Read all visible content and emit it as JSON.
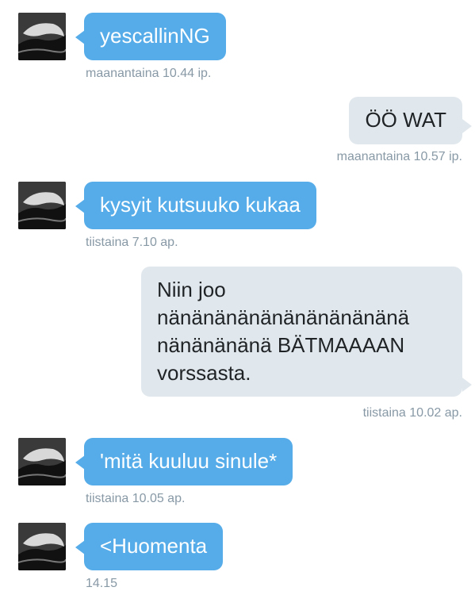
{
  "messages": [
    {
      "direction": "in",
      "text": "yescallinNG",
      "time": "maanantaina 10.44 ip."
    },
    {
      "direction": "out",
      "text": "ÖÖ WAT",
      "time": "maanantaina 10.57 ip."
    },
    {
      "direction": "in",
      "text": "kysyit kutsuuko kukaa",
      "time": "tiistaina 7.10 ap."
    },
    {
      "direction": "out",
      "lines": [
        "Niin joo",
        "nänänänänänänänänänänä",
        "nänänänänä BÄTMAAAAN",
        "vorssasta."
      ],
      "time": "tiistaina 10.02 ap."
    },
    {
      "direction": "in",
      "text": "'mitä kuuluu sinule*",
      "time": "tiistaina 10.05 ap."
    },
    {
      "direction": "in",
      "text": "<Huomenta",
      "time": "14.15"
    }
  ],
  "colors": {
    "incoming": "#55ace8",
    "outgoing": "#e1e8ed",
    "timestamp": "#8899a6"
  },
  "icons": {
    "avatar": "user-avatar-image"
  }
}
